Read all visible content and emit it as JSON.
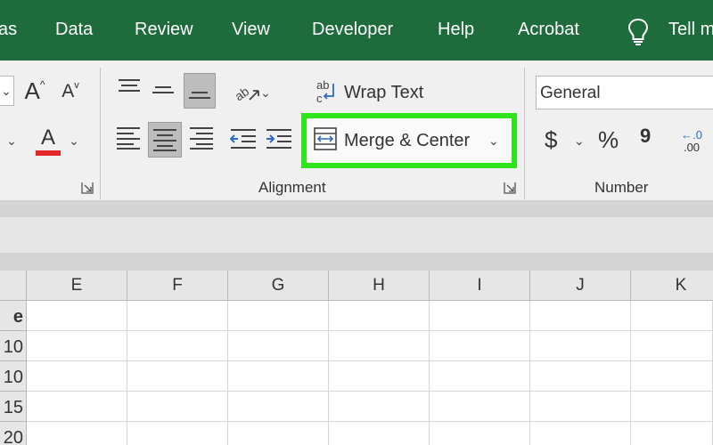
{
  "menu": {
    "tabs": [
      {
        "label": "as"
      },
      {
        "label": "Data"
      },
      {
        "label": "Review"
      },
      {
        "label": "View"
      },
      {
        "label": "Developer"
      },
      {
        "label": "Help"
      },
      {
        "label": "Acrobat"
      },
      {
        "label": "Tell m"
      }
    ],
    "tell_me_icon": "lightbulb-icon"
  },
  "ribbon": {
    "font_group": {
      "increase_font_label": "A",
      "decrease_font_label": "A",
      "font_color_label": "A",
      "font_color": "#e3262a"
    },
    "alignment_group": {
      "label": "Alignment",
      "wrap_text_label": "Wrap Text",
      "merge_center_label": "Merge & Center",
      "highlight_color": "#2ee51b"
    },
    "number_group": {
      "label": "Number",
      "format_value": "General",
      "currency_symbol": "$",
      "percent_symbol": "%",
      "comma_symbol": "9",
      "increase_decimal_top": "←.0",
      "increase_decimal_bottom": ".00"
    }
  },
  "grid": {
    "columns": [
      "E",
      "F",
      "G",
      "H",
      "I",
      "J",
      "K"
    ],
    "rows": [
      {
        "header": "e"
      },
      {
        "header": "10"
      },
      {
        "header": "10"
      },
      {
        "header": "15"
      },
      {
        "header": "20"
      }
    ]
  },
  "colors": {
    "menubar": "#1e6b3c",
    "ribbon": "#f0f0f0",
    "highlight": "#2ee51b"
  }
}
